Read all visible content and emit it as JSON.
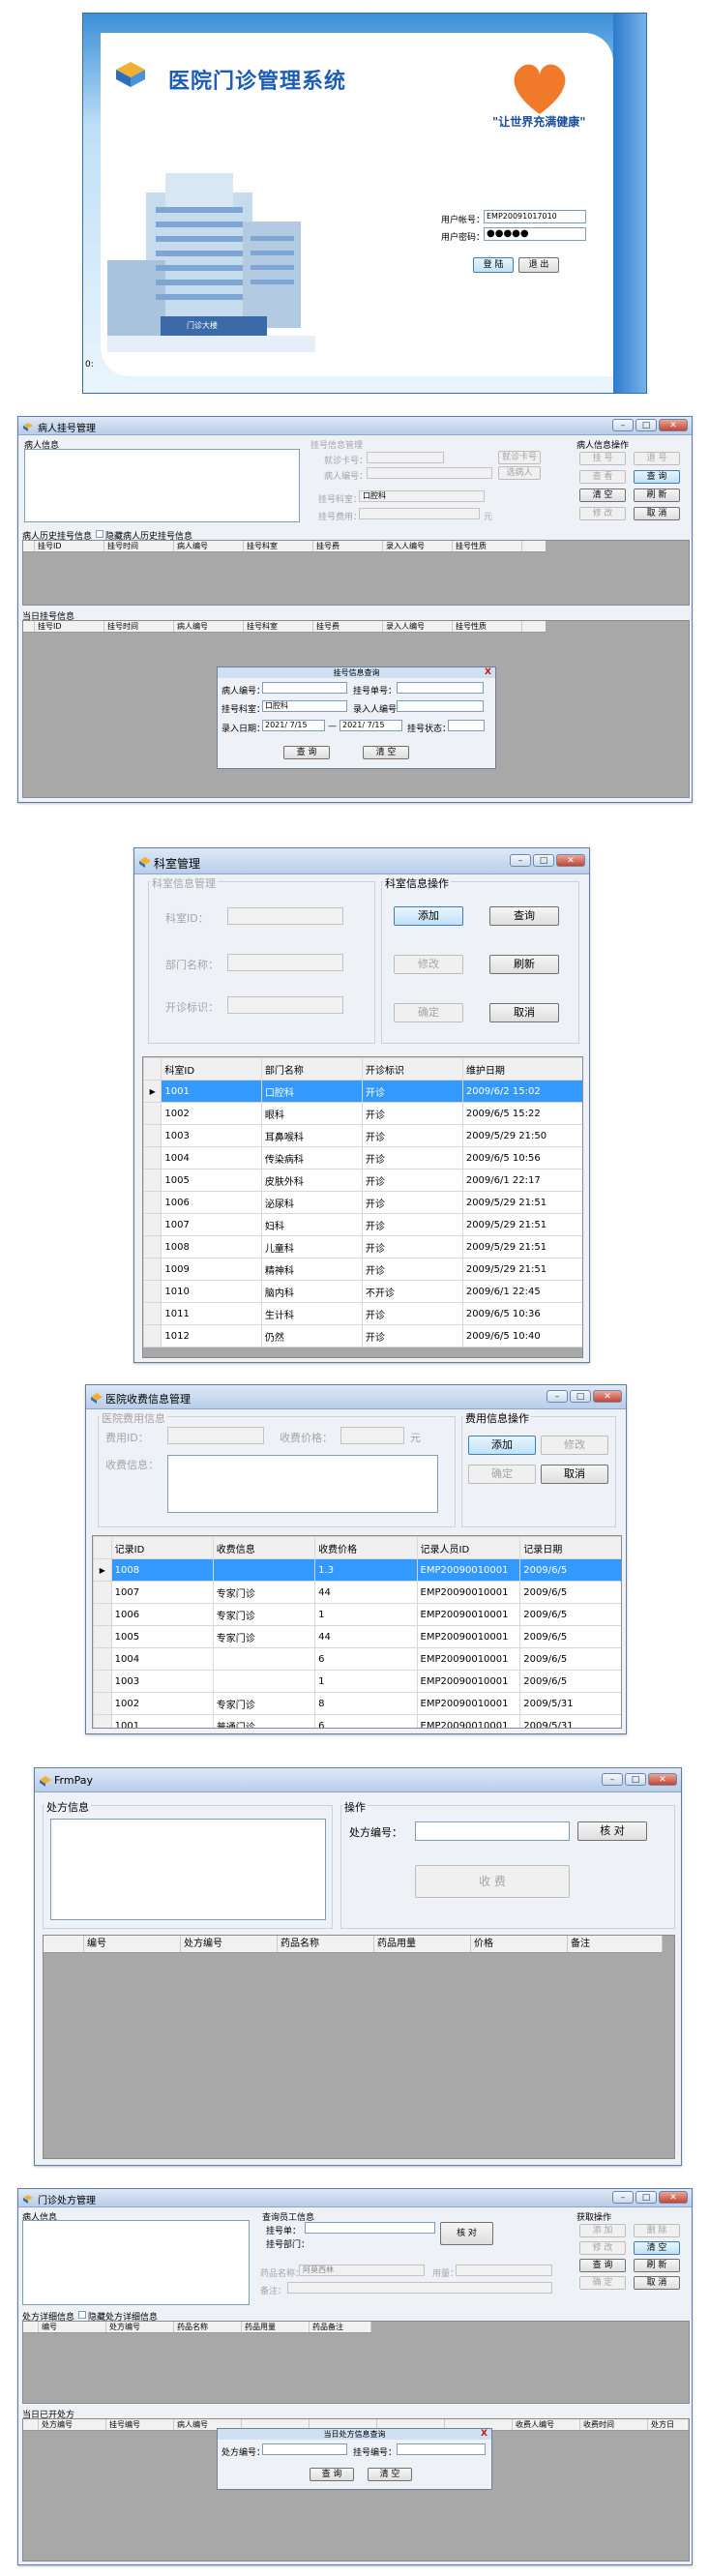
{
  "login": {
    "system_title": "医院门诊管理系统",
    "slogan": "\"让世界充满健康\"",
    "account_label": "用户帐号：",
    "account_value": "EMP20091017010",
    "password_label": "用户密码：",
    "password_value": "●●●●●",
    "login_button": "登 陆",
    "exit_button": "退 出",
    "building_sign": "门诊大楼",
    "corner_mark": "0:"
  },
  "register": {
    "title": "病人挂号管理",
    "patient_info": "病人信息",
    "reg_info": "挂号信息管理",
    "treat_card": "就诊卡号：",
    "patient_no": "病人编号：",
    "btn_card_read": "就诊卡号",
    "btn_select_patient": "选病人",
    "dept_label": "挂号科室：",
    "dept_value": "口腔科",
    "fee_label": "挂号费用：",
    "fee_unit": "元",
    "ops_title": "病人信息操作",
    "ops": [
      "挂 号",
      "退 号",
      "查 看",
      "查 询",
      "清 空",
      "刷 新",
      "修 改",
      "取 消"
    ],
    "history_title": "病人历史挂号信息",
    "hide_history": "隐藏病人历史挂号信息",
    "today_title": "当日挂号信息",
    "grid_cols": [
      "挂号ID",
      "挂号时间",
      "病人编号",
      "挂号科室",
      "挂号费",
      "录入人编号",
      "挂号性质"
    ],
    "today_cols": [
      "挂号ID",
      "挂号时间",
      "病人编号",
      "挂号科室",
      "挂号费",
      "录入人编号",
      "挂号性质"
    ],
    "query": {
      "title": "挂号信息查询",
      "close": "X",
      "patient_no": "病人编号：",
      "reg_no": "挂号单号：",
      "dept": "挂号科室：",
      "dept_value": "口腔科",
      "entry_no": "录入人编号：",
      "entry_date": "录入日期：",
      "date_from": "2021/ 7/15",
      "to": "—",
      "date_to": "2021/ 7/15",
      "status": "挂号状态：",
      "btn_query": "查 询",
      "btn_clear": "清 空"
    }
  },
  "dept": {
    "title": "科室管理",
    "info": "科室信息管理",
    "ops": "科室信息操作",
    "id_label": "科室ID：",
    "name_label": "部门名称：",
    "flag_label": "开诊标识：",
    "btn_add": "添加",
    "btn_query": "查询",
    "btn_edit": "修改",
    "btn_refresh": "刷新",
    "btn_ok": "确定",
    "btn_cancel": "取消",
    "cols": [
      "科室ID",
      "部门名称",
      "开诊标识",
      "维护日期"
    ],
    "rows": [
      [
        "1001",
        "口腔科",
        "开诊",
        "2009/6/2 15:02"
      ],
      [
        "1002",
        "眼科",
        "开诊",
        "2009/6/5 15:22"
      ],
      [
        "1003",
        "耳鼻喉科",
        "开诊",
        "2009/5/29 21:50"
      ],
      [
        "1004",
        "传染病科",
        "开诊",
        "2009/6/5 10:56"
      ],
      [
        "1005",
        "皮肤外科",
        "开诊",
        "2009/6/1 22:17"
      ],
      [
        "1006",
        "泌尿科",
        "开诊",
        "2009/5/29 21:51"
      ],
      [
        "1007",
        "妇科",
        "开诊",
        "2009/5/29 21:51"
      ],
      [
        "1008",
        "儿童科",
        "开诊",
        "2009/5/29 21:51"
      ],
      [
        "1009",
        "精神科",
        "开诊",
        "2009/5/29 21:51"
      ],
      [
        "1010",
        "脑内科",
        "不开诊",
        "2009/6/1 22:45"
      ],
      [
        "1011",
        "生计科",
        "开诊",
        "2009/6/5 10:36"
      ],
      [
        "1012",
        "仍然",
        "开诊",
        "2009/6/5 10:40"
      ]
    ]
  },
  "fee": {
    "title": "医院收费信息管理",
    "info": "医院费用信息",
    "ops": "费用信息操作",
    "fee_id": "费用ID：",
    "fee_price": "收费价格：",
    "unit": "元",
    "fee_info": "收费信息：",
    "btn_add": "添加",
    "btn_edit": "修改",
    "btn_ok": "确定",
    "btn_cancel": "取消",
    "cols": [
      "记录ID",
      "收费信息",
      "收费价格",
      "记录人员ID",
      "记录日期"
    ],
    "rows": [
      [
        "1008",
        "",
        "1.3",
        "EMP20090010001",
        "2009/6/5"
      ],
      [
        "1007",
        "专家门诊",
        "44",
        "EMP20090010001",
        "2009/6/5"
      ],
      [
        "1006",
        "专家门诊",
        "1",
        "EMP20090010001",
        "2009/6/5"
      ],
      [
        "1005",
        "专家门诊",
        "44",
        "EMP20090010001",
        "2009/6/5"
      ],
      [
        "1004",
        "",
        "6",
        "EMP20090010001",
        "2009/6/5"
      ],
      [
        "1003",
        "",
        "1",
        "EMP20090010001",
        "2009/6/5"
      ],
      [
        "1002",
        "专家门诊",
        "8",
        "EMP20090010001",
        "2009/5/31"
      ],
      [
        "1001",
        "普通门诊",
        "6",
        "EMP20090010001",
        "2009/5/31"
      ]
    ]
  },
  "pay": {
    "title": "FrmPay",
    "info": "处方信息",
    "ops": "操作",
    "rx_no": "处方编号：",
    "btn_check": "核 对",
    "btn_charge": "收 费",
    "cols": [
      "编号",
      "处方编号",
      "药品名称",
      "药品用量",
      "价格",
      "备注"
    ]
  },
  "rx": {
    "title": "门诊处方管理",
    "patient_info": "病人信息",
    "staff_info": "查询员工信息",
    "reg_no": "挂号单：",
    "reg_dept": "挂号部门：",
    "btn_check": "核 对",
    "drug_name": "药品名称：",
    "drug_value": "阿莫西林",
    "amount": "用量：",
    "remark": "备注：",
    "ops_title": "获取操作",
    "ops": [
      "添 加",
      "删 除",
      "修 改",
      "清 空",
      "查 询",
      "刷 新",
      "确 定",
      "取 消"
    ],
    "detail_title": "处方详细信息",
    "hide_detail": "隐藏处方详细信息",
    "detail_cols": [
      "编号",
      "处方编号",
      "药品名称",
      "药品用量",
      "药品备注"
    ],
    "today_title": "当日已开处方",
    "today_cols": [
      "处方编号",
      "挂号编号",
      "病人编号",
      "",
      "",
      "",
      "",
      "收费人编号",
      "收费时间",
      "处方日"
    ],
    "query": {
      "title": "当日处方信息查询",
      "close": "X",
      "rx_no": "处方编号：",
      "reg_no": "挂号编号：",
      "btn_query": "查 询",
      "btn_clear": "清 空"
    }
  }
}
